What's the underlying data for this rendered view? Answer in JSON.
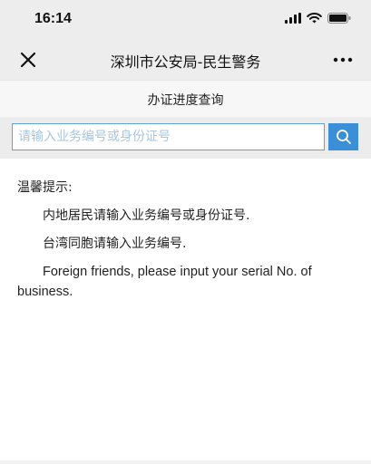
{
  "status_bar": {
    "time": "16:14"
  },
  "nav": {
    "title": "深圳市公安局-民生警务"
  },
  "page": {
    "title": "办证进度查询"
  },
  "search": {
    "placeholder": "请输入业务编号或身份证号",
    "value": ""
  },
  "tips": {
    "title": "温馨提示:",
    "lines": [
      "内地居民请输入业务编号或身份证号.",
      "台湾同胞请输入业务编号.",
      "Foreign friends, please input your serial No. of business."
    ]
  },
  "icons": {
    "status": [
      "signal-icon",
      "wifi-icon",
      "battery-icon"
    ],
    "nav_left": "close-icon",
    "nav_right": "more-icon",
    "search": "search-icon"
  },
  "colors": {
    "accent": "#3b8fd6",
    "input_border": "#5ba3d9",
    "bar_bg": "#ededed"
  }
}
